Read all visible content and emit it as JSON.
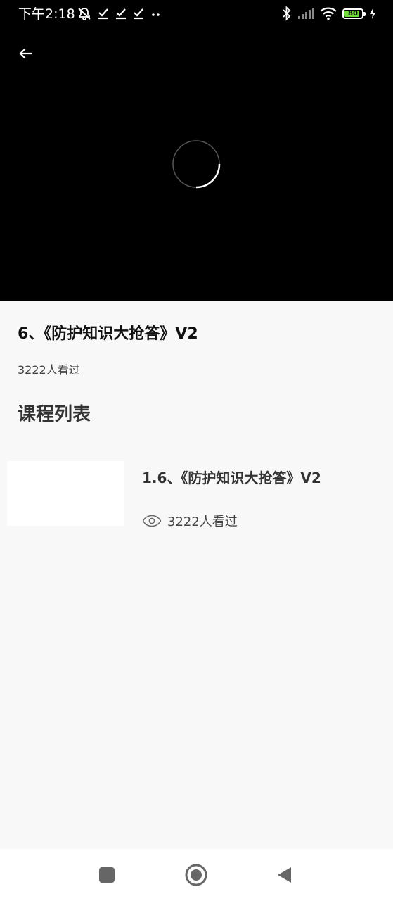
{
  "status_bar": {
    "time": "下午2:18",
    "battery_level": "80",
    "icons": [
      "mute-icon",
      "check-icon",
      "check-icon",
      "check-icon",
      "more-dots-icon",
      "bluetooth-icon",
      "signal-icon",
      "wifi-icon",
      "battery-icon",
      "charging-icon"
    ],
    "battery_color": "#6fdc3c"
  },
  "video": {
    "state": "loading",
    "back_icon": "arrow-left-icon"
  },
  "course": {
    "title": "6、《防护知识大抢答》V2",
    "views": "3222人看过"
  },
  "list_section": {
    "title": "课程列表"
  },
  "lessons": [
    {
      "title": "1.6、《防护知识大抢答》V2",
      "views": "3222人看过",
      "icon": "eye-icon"
    }
  ],
  "nav_bar": {
    "buttons": [
      "recents-square-icon",
      "home-circle-icon",
      "back-triangle-icon"
    ]
  }
}
